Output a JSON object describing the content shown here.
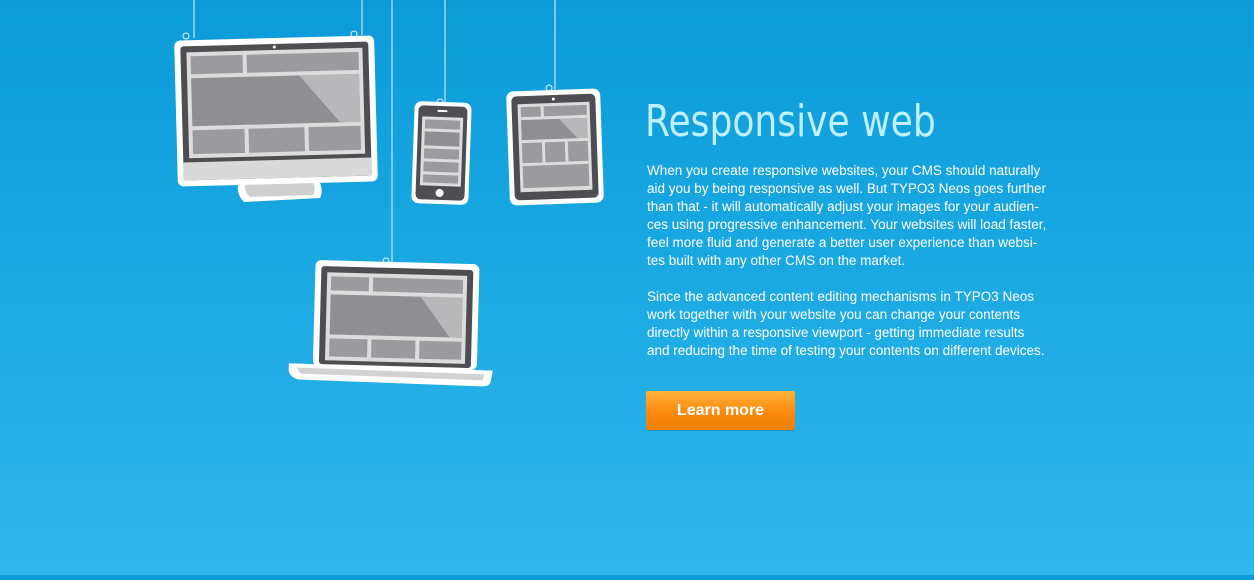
{
  "section": {
    "title": "Responsive web",
    "paragraphs": [
      "When you create responsive websites, your CMS should naturally\naid you by being responsive as well. But TYPO3 Neos goes further\nthan that - it will automatically adjust your images for your audien-\nces using progressive enhancement. Your websites will load faster,\nfeel more fluid and generate a better user experience than websi-\ntes built with any other CMS on the market.",
      "Since the advanced content editing mechanisms in TYPO3 Neos\nwork together with your website you can change your contents\ndirectly within a responsive viewport - getting immediate results\nand reducing the time of testing your contents on different devices."
    ],
    "cta_label": "Learn more"
  },
  "illustration": {
    "devices": [
      "desktop-monitor-icon",
      "smartphone-icon",
      "tablet-icon",
      "laptop-icon"
    ]
  },
  "colors": {
    "background_top": "#0b9bd8",
    "background_bottom": "#30b6ec",
    "title": "#bff0ff",
    "button": "#fb8a0f"
  }
}
